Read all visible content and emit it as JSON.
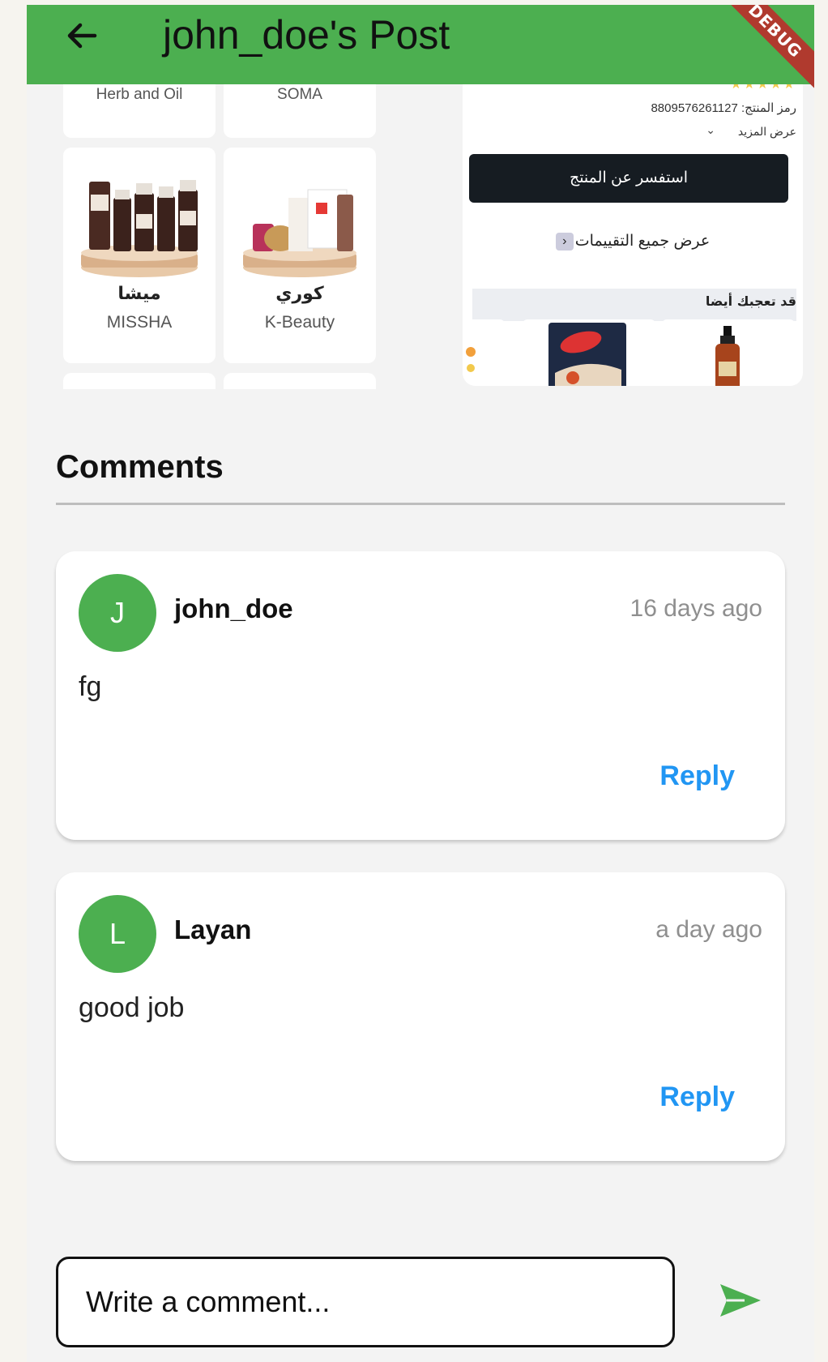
{
  "appbar": {
    "title": "john_doe's Post",
    "debug_label": "DEBUG",
    "back_icon": "arrow-back-icon",
    "color": "#4caf50"
  },
  "post_image": {
    "brands_top": [
      "Herb and Oil",
      "SOMA"
    ],
    "brands": [
      {
        "arabic": "ميشا",
        "english": "MISSHA"
      },
      {
        "arabic": "كوري",
        "english": "K-Beauty"
      }
    ],
    "shop": {
      "sku": "رمز المنتج: 8809576261127",
      "show_more": "عرض المزيد",
      "ask_button": "استفسر عن المنتج",
      "all_reviews": "عرض جميع التقييمات",
      "might_like": "قد تعجبك أيضا"
    }
  },
  "comments": {
    "title": "Comments",
    "items": [
      {
        "initial": "J",
        "user": "john_doe",
        "time": "16 days ago",
        "text": "fg",
        "reply": "Reply"
      },
      {
        "initial": "L",
        "user": "Layan",
        "time": "a day ago",
        "text": "good job",
        "reply": "Reply"
      }
    ]
  },
  "input": {
    "placeholder": "Write a comment...",
    "send_icon": "send-icon"
  },
  "colors": {
    "accent": "#4caf50",
    "reply": "#2196f3"
  }
}
